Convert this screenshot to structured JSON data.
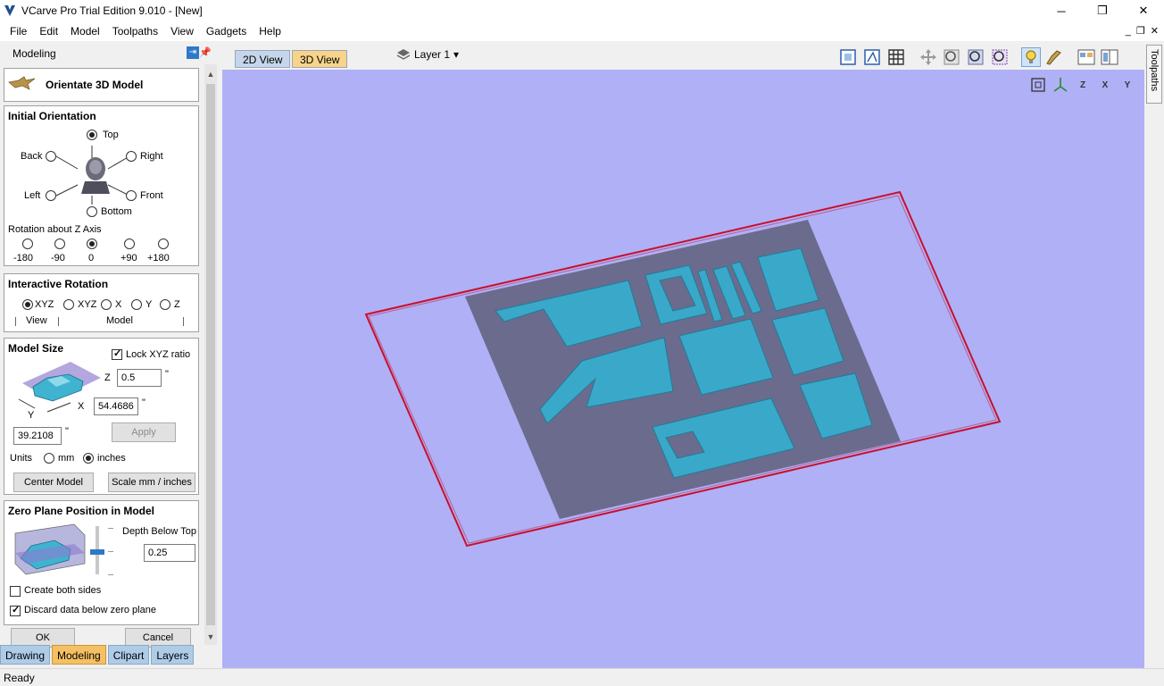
{
  "window": {
    "title": "VCarve Pro Trial Edition 9.010 - [New]",
    "minimize": "─",
    "maximize": "❐",
    "close": "✕"
  },
  "menu": {
    "items": [
      "File",
      "Edit",
      "Model",
      "Toolpaths",
      "View",
      "Gadgets",
      "Help"
    ],
    "mdi_minimize": "_",
    "mdi_restore": "❐",
    "mdi_close": "✕"
  },
  "left_panel": {
    "header": "Modeling",
    "orientate_label": "Orientate 3D Model",
    "initial_orientation": {
      "title": "Initial Orientation",
      "top": "Top",
      "back": "Back",
      "right": "Right",
      "left": "Left",
      "front": "Front",
      "bottom": "Bottom",
      "selected": "Top",
      "rotation_label": "Rotation about Z Axis",
      "rotation_options": [
        "-180",
        "-90",
        "0",
        "+90",
        "+180"
      ],
      "rotation_selected": "0"
    },
    "interactive_rotation": {
      "title": "Interactive Rotation",
      "options": [
        "XYZ",
        "XYZ",
        "X",
        "Y",
        "Z"
      ],
      "selected_index": 0,
      "view_label": "View",
      "model_label": "Model"
    },
    "model_size": {
      "title": "Model Size",
      "lock_label": "Lock XYZ ratio",
      "lock_checked": true,
      "z_label": "Z",
      "z_value": "0.5",
      "x_label": "X",
      "x_value": "54.4686",
      "y_label": "Y",
      "y_value": "39.2108",
      "unit_mark": "\"",
      "apply_label": "Apply",
      "units_label": "Units",
      "mm_label": "mm",
      "inches_label": "inches",
      "units_selected": "inches",
      "center_label": "Center Model",
      "scale_label": "Scale mm / inches"
    },
    "zero_plane": {
      "title": "Zero Plane Position in Model",
      "depth_label": "Depth Below Top",
      "depth_value": "0.25",
      "create_both_label": "Create both sides",
      "create_both_checked": false,
      "discard_label": "Discard data below zero plane",
      "discard_checked": true
    },
    "ok_label": "OK",
    "cancel_label": "Cancel"
  },
  "bottom_tabs": [
    "Drawing",
    "Modeling",
    "Clipart",
    "Layers"
  ],
  "bottom_tab_active": "Modeling",
  "view_tabs": {
    "tab_2d": "2D View",
    "tab_3d": "3D View",
    "active": "3D View"
  },
  "layer_selector": "Layer 1",
  "view_axis_icons": [
    "Z",
    "X",
    "Y"
  ],
  "side_tab": "Toolpaths",
  "status": "Ready",
  "colors": {
    "viewport_bg": "#b0b0f6",
    "material_plane": "#6b6b8e",
    "parts": "#3aa9c9",
    "outline": "#c8102e",
    "active_tab": "#f5c064",
    "inactive_tab": "#aecbe8"
  }
}
